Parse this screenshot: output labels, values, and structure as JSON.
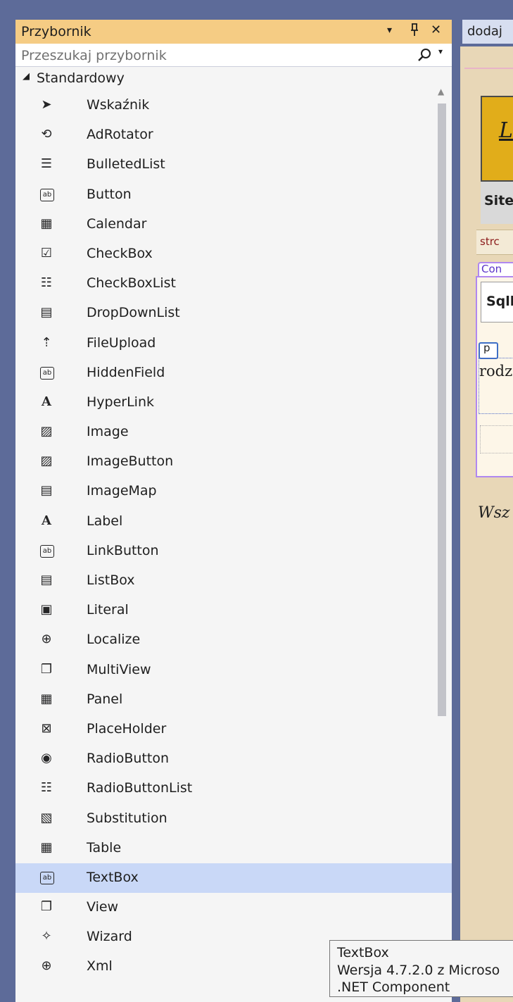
{
  "toolbox": {
    "title": "Przybornik",
    "header_buttons": {
      "dropdown": "▾",
      "pin": "ꟷ",
      "close": "✕"
    },
    "search": {
      "placeholder": "Przeszukaj przybornik",
      "value": "",
      "dropdown": "▾"
    },
    "category": {
      "label": "Standardowy",
      "arrow": "◢",
      "expanded": true
    },
    "items": [
      {
        "label": "Wskaźnik",
        "icon": "pointer-icon",
        "glyph": "➤"
      },
      {
        "label": "AdRotator",
        "icon": "adrotator-icon",
        "glyph": "⟲"
      },
      {
        "label": "BulletedList",
        "icon": "bulleted-list-icon",
        "glyph": "☰"
      },
      {
        "label": "Button",
        "icon": "button-icon",
        "glyph": "ab"
      },
      {
        "label": "Calendar",
        "icon": "calendar-icon",
        "glyph": "▦"
      },
      {
        "label": "CheckBox",
        "icon": "checkbox-icon",
        "glyph": "☑"
      },
      {
        "label": "CheckBoxList",
        "icon": "checkbox-list-icon",
        "glyph": "☷"
      },
      {
        "label": "DropDownList",
        "icon": "dropdown-list-icon",
        "glyph": "▤"
      },
      {
        "label": "FileUpload",
        "icon": "file-upload-icon",
        "glyph": "⇡"
      },
      {
        "label": "HiddenField",
        "icon": "hidden-field-icon",
        "glyph": "ab"
      },
      {
        "label": "HyperLink",
        "icon": "hyperlink-icon",
        "glyph": "A"
      },
      {
        "label": "Image",
        "icon": "image-icon",
        "glyph": "▨"
      },
      {
        "label": "ImageButton",
        "icon": "image-button-icon",
        "glyph": "▨"
      },
      {
        "label": "ImageMap",
        "icon": "image-map-icon",
        "glyph": "▤"
      },
      {
        "label": "Label",
        "icon": "label-icon",
        "glyph": "A"
      },
      {
        "label": "LinkButton",
        "icon": "link-button-icon",
        "glyph": "ab"
      },
      {
        "label": "ListBox",
        "icon": "listbox-icon",
        "glyph": "▤"
      },
      {
        "label": "Literal",
        "icon": "literal-icon",
        "glyph": "▣"
      },
      {
        "label": "Localize",
        "icon": "localize-icon",
        "glyph": "⊕"
      },
      {
        "label": "MultiView",
        "icon": "multiview-icon",
        "glyph": "❐"
      },
      {
        "label": "Panel",
        "icon": "panel-icon",
        "glyph": "▦"
      },
      {
        "label": "PlaceHolder",
        "icon": "placeholder-icon",
        "glyph": "⊠"
      },
      {
        "label": "RadioButton",
        "icon": "radio-button-icon",
        "glyph": "◉"
      },
      {
        "label": "RadioButtonList",
        "icon": "radio-button-list-icon",
        "glyph": "☷"
      },
      {
        "label": "Substitution",
        "icon": "substitution-icon",
        "glyph": "▧"
      },
      {
        "label": "Table",
        "icon": "table-icon",
        "glyph": "▦"
      },
      {
        "label": "TextBox",
        "icon": "textbox-icon",
        "glyph": "ab",
        "selected": true
      },
      {
        "label": "View",
        "icon": "view-icon",
        "glyph": "❐"
      },
      {
        "label": "Wizard",
        "icon": "wizard-icon",
        "glyph": "✧"
      },
      {
        "label": "Xml",
        "icon": "xml-icon",
        "glyph": "⊕"
      }
    ]
  },
  "designer": {
    "tab_label": "dodaj",
    "logo_text": "L",
    "site_text": "Site",
    "strc_text": "strc",
    "content_tag": "Con",
    "sql_text": "Sqll",
    "p_tag": "p",
    "p_text": "rodz",
    "italic_text": "Wsz"
  },
  "tooltip": {
    "title": "TextBox",
    "version": "Wersja 4.7.2.0 z Microso",
    "component": ".NET Component"
  },
  "colors": {
    "accent_header": "#f5cc84",
    "selected_row": "#c9d8f7",
    "frame": "#5d6b99"
  }
}
